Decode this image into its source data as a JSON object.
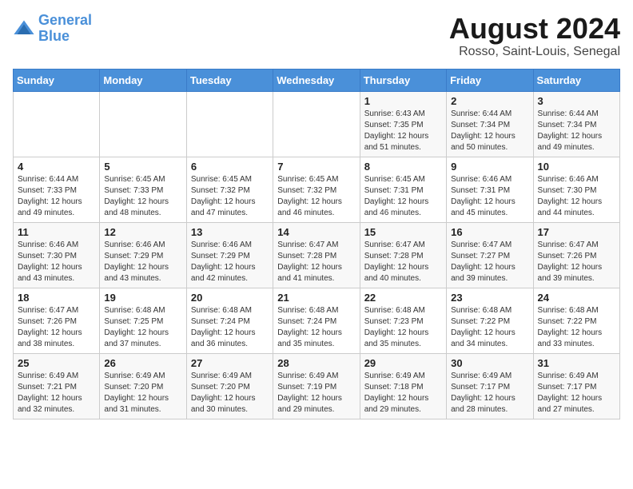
{
  "header": {
    "logo_line1": "General",
    "logo_line2": "Blue",
    "month_year": "August 2024",
    "location": "Rosso, Saint-Louis, Senegal"
  },
  "days_of_week": [
    "Sunday",
    "Monday",
    "Tuesday",
    "Wednesday",
    "Thursday",
    "Friday",
    "Saturday"
  ],
  "weeks": [
    [
      {
        "day": "",
        "info": ""
      },
      {
        "day": "",
        "info": ""
      },
      {
        "day": "",
        "info": ""
      },
      {
        "day": "",
        "info": ""
      },
      {
        "day": "1",
        "info": "Sunrise: 6:43 AM\nSunset: 7:35 PM\nDaylight: 12 hours\nand 51 minutes."
      },
      {
        "day": "2",
        "info": "Sunrise: 6:44 AM\nSunset: 7:34 PM\nDaylight: 12 hours\nand 50 minutes."
      },
      {
        "day": "3",
        "info": "Sunrise: 6:44 AM\nSunset: 7:34 PM\nDaylight: 12 hours\nand 49 minutes."
      }
    ],
    [
      {
        "day": "4",
        "info": "Sunrise: 6:44 AM\nSunset: 7:33 PM\nDaylight: 12 hours\nand 49 minutes."
      },
      {
        "day": "5",
        "info": "Sunrise: 6:45 AM\nSunset: 7:33 PM\nDaylight: 12 hours\nand 48 minutes."
      },
      {
        "day": "6",
        "info": "Sunrise: 6:45 AM\nSunset: 7:32 PM\nDaylight: 12 hours\nand 47 minutes."
      },
      {
        "day": "7",
        "info": "Sunrise: 6:45 AM\nSunset: 7:32 PM\nDaylight: 12 hours\nand 46 minutes."
      },
      {
        "day": "8",
        "info": "Sunrise: 6:45 AM\nSunset: 7:31 PM\nDaylight: 12 hours\nand 46 minutes."
      },
      {
        "day": "9",
        "info": "Sunrise: 6:46 AM\nSunset: 7:31 PM\nDaylight: 12 hours\nand 45 minutes."
      },
      {
        "day": "10",
        "info": "Sunrise: 6:46 AM\nSunset: 7:30 PM\nDaylight: 12 hours\nand 44 minutes."
      }
    ],
    [
      {
        "day": "11",
        "info": "Sunrise: 6:46 AM\nSunset: 7:30 PM\nDaylight: 12 hours\nand 43 minutes."
      },
      {
        "day": "12",
        "info": "Sunrise: 6:46 AM\nSunset: 7:29 PM\nDaylight: 12 hours\nand 43 minutes."
      },
      {
        "day": "13",
        "info": "Sunrise: 6:46 AM\nSunset: 7:29 PM\nDaylight: 12 hours\nand 42 minutes."
      },
      {
        "day": "14",
        "info": "Sunrise: 6:47 AM\nSunset: 7:28 PM\nDaylight: 12 hours\nand 41 minutes."
      },
      {
        "day": "15",
        "info": "Sunrise: 6:47 AM\nSunset: 7:28 PM\nDaylight: 12 hours\nand 40 minutes."
      },
      {
        "day": "16",
        "info": "Sunrise: 6:47 AM\nSunset: 7:27 PM\nDaylight: 12 hours\nand 39 minutes."
      },
      {
        "day": "17",
        "info": "Sunrise: 6:47 AM\nSunset: 7:26 PM\nDaylight: 12 hours\nand 39 minutes."
      }
    ],
    [
      {
        "day": "18",
        "info": "Sunrise: 6:47 AM\nSunset: 7:26 PM\nDaylight: 12 hours\nand 38 minutes."
      },
      {
        "day": "19",
        "info": "Sunrise: 6:48 AM\nSunset: 7:25 PM\nDaylight: 12 hours\nand 37 minutes."
      },
      {
        "day": "20",
        "info": "Sunrise: 6:48 AM\nSunset: 7:24 PM\nDaylight: 12 hours\nand 36 minutes."
      },
      {
        "day": "21",
        "info": "Sunrise: 6:48 AM\nSunset: 7:24 PM\nDaylight: 12 hours\nand 35 minutes."
      },
      {
        "day": "22",
        "info": "Sunrise: 6:48 AM\nSunset: 7:23 PM\nDaylight: 12 hours\nand 35 minutes."
      },
      {
        "day": "23",
        "info": "Sunrise: 6:48 AM\nSunset: 7:22 PM\nDaylight: 12 hours\nand 34 minutes."
      },
      {
        "day": "24",
        "info": "Sunrise: 6:48 AM\nSunset: 7:22 PM\nDaylight: 12 hours\nand 33 minutes."
      }
    ],
    [
      {
        "day": "25",
        "info": "Sunrise: 6:49 AM\nSunset: 7:21 PM\nDaylight: 12 hours\nand 32 minutes."
      },
      {
        "day": "26",
        "info": "Sunrise: 6:49 AM\nSunset: 7:20 PM\nDaylight: 12 hours\nand 31 minutes."
      },
      {
        "day": "27",
        "info": "Sunrise: 6:49 AM\nSunset: 7:20 PM\nDaylight: 12 hours\nand 30 minutes."
      },
      {
        "day": "28",
        "info": "Sunrise: 6:49 AM\nSunset: 7:19 PM\nDaylight: 12 hours\nand 29 minutes."
      },
      {
        "day": "29",
        "info": "Sunrise: 6:49 AM\nSunset: 7:18 PM\nDaylight: 12 hours\nand 29 minutes."
      },
      {
        "day": "30",
        "info": "Sunrise: 6:49 AM\nSunset: 7:17 PM\nDaylight: 12 hours\nand 28 minutes."
      },
      {
        "day": "31",
        "info": "Sunrise: 6:49 AM\nSunset: 7:17 PM\nDaylight: 12 hours\nand 27 minutes."
      }
    ]
  ]
}
